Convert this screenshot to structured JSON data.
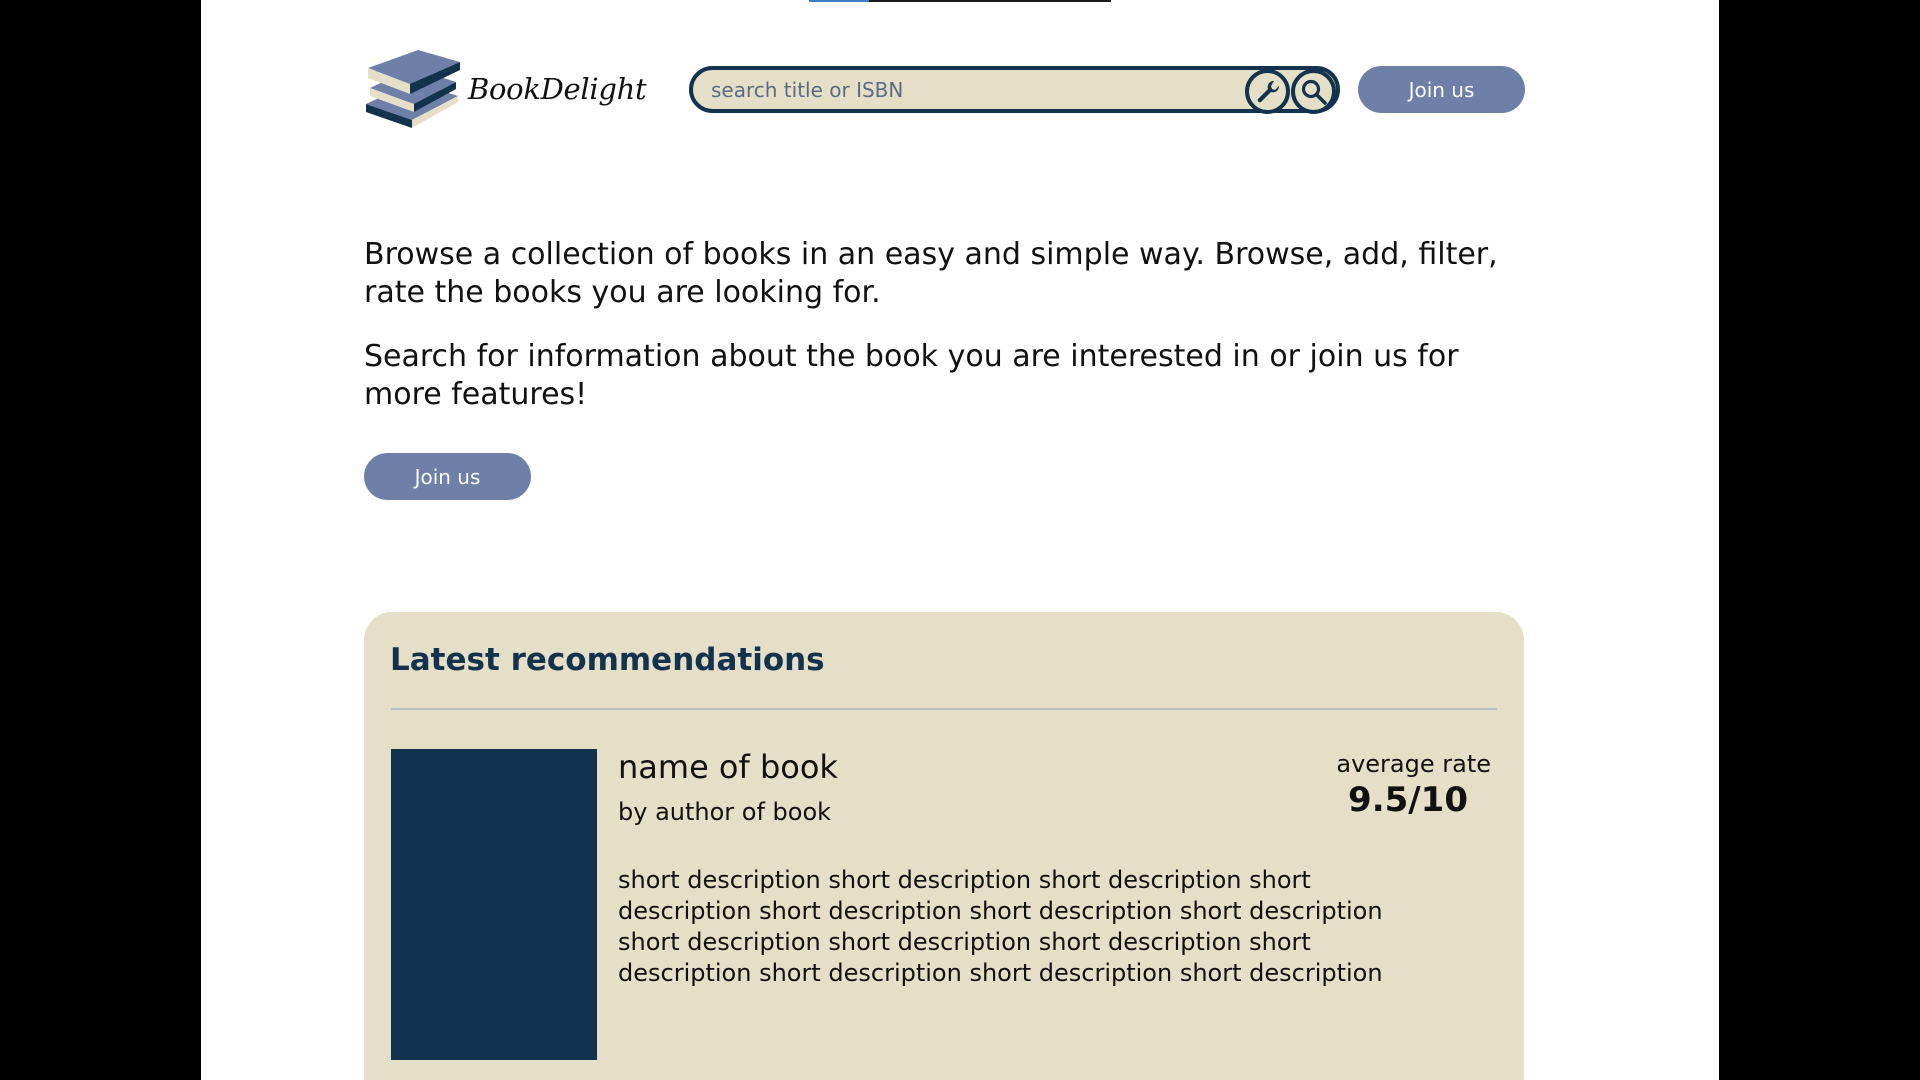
{
  "header": {
    "logo_text": "BookDelight",
    "search_placeholder": "search title or ISBN",
    "join_label": "Join us",
    "icons": [
      "books-logo-icon",
      "wrench-icon",
      "search-icon"
    ]
  },
  "intro": {
    "paragraph_1": "Browse a collection of books in an easy and simple way. Browse, add, filter, rate the books you are looking for.",
    "paragraph_2": "Search for information about the book you are interested in or join us for more features!",
    "join_label": "Join us"
  },
  "recommendations": {
    "title": "Latest recommendations",
    "items": [
      {
        "name": "name of book",
        "author": "by author of book",
        "description": "short description short description short description  short description short description short description  short description short description short description  short description short description  short description short description short description",
        "rate_label": "average rate",
        "rate_value": "9.5/10"
      }
    ]
  },
  "colors": {
    "accent": "#6e7fa8",
    "navy": "#13324d",
    "beige": "#e5dfc7"
  }
}
